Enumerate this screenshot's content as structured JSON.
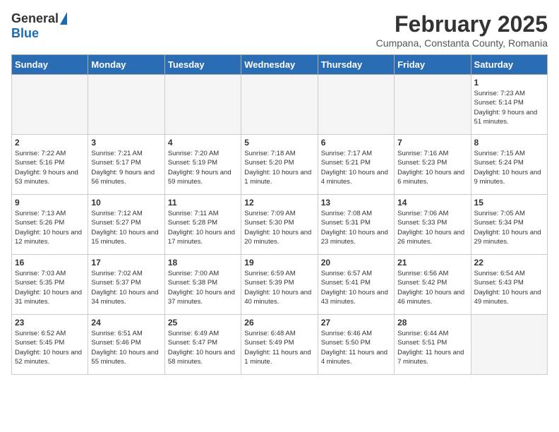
{
  "logo": {
    "general": "General",
    "blue": "Blue"
  },
  "title": "February 2025",
  "subtitle": "Cumpana, Constanta County, Romania",
  "weekdays": [
    "Sunday",
    "Monday",
    "Tuesday",
    "Wednesday",
    "Thursday",
    "Friday",
    "Saturday"
  ],
  "weeks": [
    [
      {
        "day": "",
        "info": ""
      },
      {
        "day": "",
        "info": ""
      },
      {
        "day": "",
        "info": ""
      },
      {
        "day": "",
        "info": ""
      },
      {
        "day": "",
        "info": ""
      },
      {
        "day": "",
        "info": ""
      },
      {
        "day": "1",
        "info": "Sunrise: 7:23 AM\nSunset: 5:14 PM\nDaylight: 9 hours and 51 minutes."
      }
    ],
    [
      {
        "day": "2",
        "info": "Sunrise: 7:22 AM\nSunset: 5:16 PM\nDaylight: 9 hours and 53 minutes."
      },
      {
        "day": "3",
        "info": "Sunrise: 7:21 AM\nSunset: 5:17 PM\nDaylight: 9 hours and 56 minutes."
      },
      {
        "day": "4",
        "info": "Sunrise: 7:20 AM\nSunset: 5:19 PM\nDaylight: 9 hours and 59 minutes."
      },
      {
        "day": "5",
        "info": "Sunrise: 7:18 AM\nSunset: 5:20 PM\nDaylight: 10 hours and 1 minute."
      },
      {
        "day": "6",
        "info": "Sunrise: 7:17 AM\nSunset: 5:21 PM\nDaylight: 10 hours and 4 minutes."
      },
      {
        "day": "7",
        "info": "Sunrise: 7:16 AM\nSunset: 5:23 PM\nDaylight: 10 hours and 6 minutes."
      },
      {
        "day": "8",
        "info": "Sunrise: 7:15 AM\nSunset: 5:24 PM\nDaylight: 10 hours and 9 minutes."
      }
    ],
    [
      {
        "day": "9",
        "info": "Sunrise: 7:13 AM\nSunset: 5:26 PM\nDaylight: 10 hours and 12 minutes."
      },
      {
        "day": "10",
        "info": "Sunrise: 7:12 AM\nSunset: 5:27 PM\nDaylight: 10 hours and 15 minutes."
      },
      {
        "day": "11",
        "info": "Sunrise: 7:11 AM\nSunset: 5:28 PM\nDaylight: 10 hours and 17 minutes."
      },
      {
        "day": "12",
        "info": "Sunrise: 7:09 AM\nSunset: 5:30 PM\nDaylight: 10 hours and 20 minutes."
      },
      {
        "day": "13",
        "info": "Sunrise: 7:08 AM\nSunset: 5:31 PM\nDaylight: 10 hours and 23 minutes."
      },
      {
        "day": "14",
        "info": "Sunrise: 7:06 AM\nSunset: 5:33 PM\nDaylight: 10 hours and 26 minutes."
      },
      {
        "day": "15",
        "info": "Sunrise: 7:05 AM\nSunset: 5:34 PM\nDaylight: 10 hours and 29 minutes."
      }
    ],
    [
      {
        "day": "16",
        "info": "Sunrise: 7:03 AM\nSunset: 5:35 PM\nDaylight: 10 hours and 31 minutes."
      },
      {
        "day": "17",
        "info": "Sunrise: 7:02 AM\nSunset: 5:37 PM\nDaylight: 10 hours and 34 minutes."
      },
      {
        "day": "18",
        "info": "Sunrise: 7:00 AM\nSunset: 5:38 PM\nDaylight: 10 hours and 37 minutes."
      },
      {
        "day": "19",
        "info": "Sunrise: 6:59 AM\nSunset: 5:39 PM\nDaylight: 10 hours and 40 minutes."
      },
      {
        "day": "20",
        "info": "Sunrise: 6:57 AM\nSunset: 5:41 PM\nDaylight: 10 hours and 43 minutes."
      },
      {
        "day": "21",
        "info": "Sunrise: 6:56 AM\nSunset: 5:42 PM\nDaylight: 10 hours and 46 minutes."
      },
      {
        "day": "22",
        "info": "Sunrise: 6:54 AM\nSunset: 5:43 PM\nDaylight: 10 hours and 49 minutes."
      }
    ],
    [
      {
        "day": "23",
        "info": "Sunrise: 6:52 AM\nSunset: 5:45 PM\nDaylight: 10 hours and 52 minutes."
      },
      {
        "day": "24",
        "info": "Sunrise: 6:51 AM\nSunset: 5:46 PM\nDaylight: 10 hours and 55 minutes."
      },
      {
        "day": "25",
        "info": "Sunrise: 6:49 AM\nSunset: 5:47 PM\nDaylight: 10 hours and 58 minutes."
      },
      {
        "day": "26",
        "info": "Sunrise: 6:48 AM\nSunset: 5:49 PM\nDaylight: 11 hours and 1 minute."
      },
      {
        "day": "27",
        "info": "Sunrise: 6:46 AM\nSunset: 5:50 PM\nDaylight: 11 hours and 4 minutes."
      },
      {
        "day": "28",
        "info": "Sunrise: 6:44 AM\nSunset: 5:51 PM\nDaylight: 11 hours and 7 minutes."
      },
      {
        "day": "",
        "info": ""
      }
    ]
  ]
}
